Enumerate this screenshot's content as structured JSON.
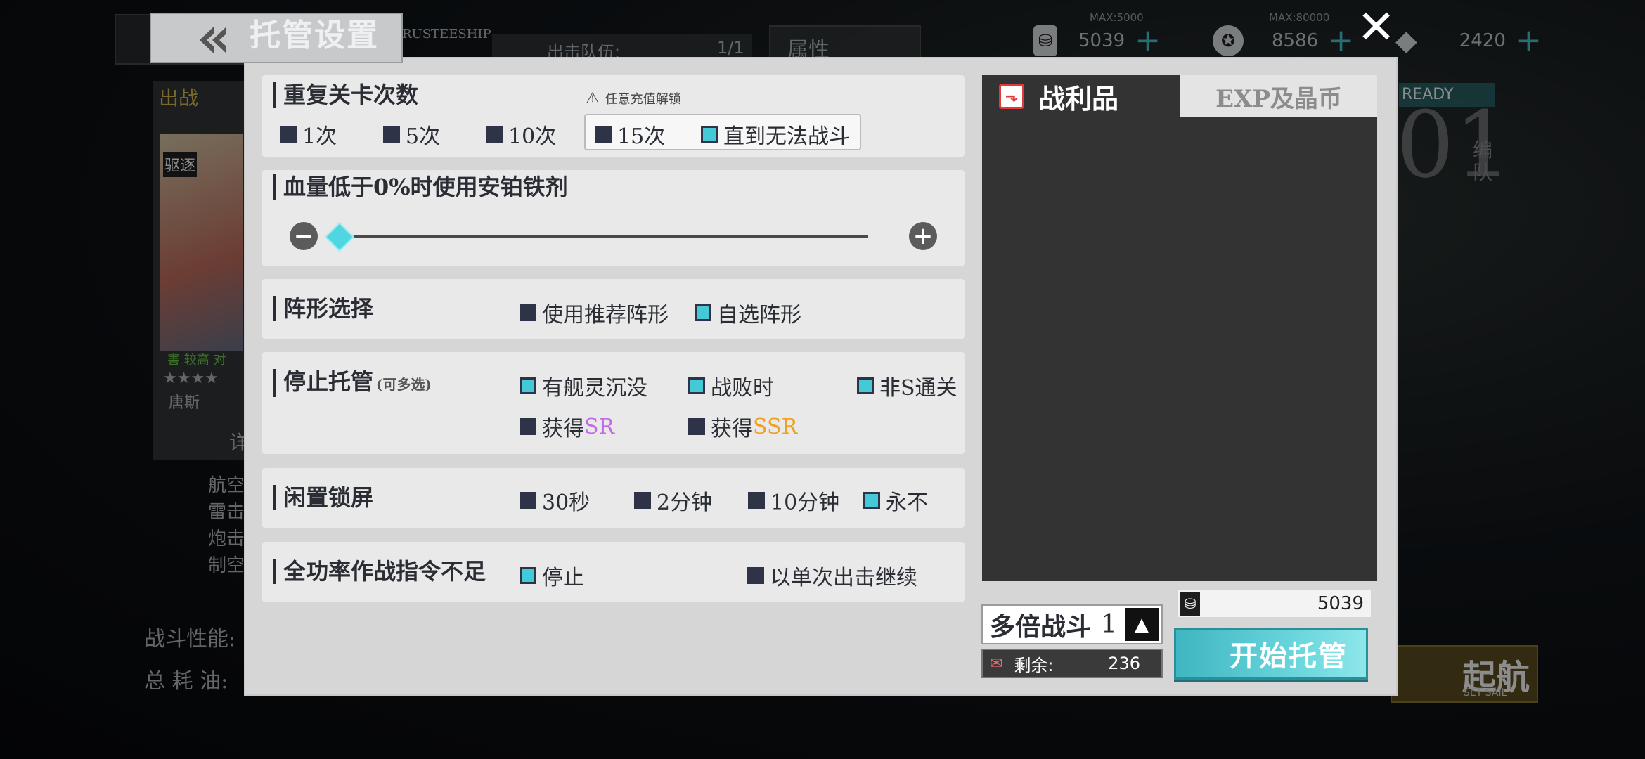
{
  "background": {
    "resources": [
      {
        "name": "oil",
        "max": "MAX:5000",
        "value": "5039"
      },
      {
        "name": "coin",
        "max": "MAX:80000",
        "value": "8586"
      },
      {
        "name": "gem",
        "value": "2420"
      }
    ],
    "fleet_label": "出击队伍:",
    "fleet_count": "1/1",
    "attribute_label": "属性",
    "trusteeship_en": "TRUSTEESHIP",
    "sortie_label": "出战",
    "ready_label": "READY",
    "fleet_number": "01",
    "fleet_word": "编队",
    "ship_name": "唐斯",
    "ship_type": "驱逐",
    "ship_tags": "害 较高  对",
    "ship_stars": "★★★★",
    "detail_label": "详",
    "stat_rows": [
      "航空",
      "雷击",
      "炮击",
      "制空"
    ],
    "perf_label": "战斗性能:",
    "total_oil_label": "总 耗 油:",
    "sail_label": "起航",
    "sail_en": "SET SAIL"
  },
  "dialog": {
    "title": "托管设置",
    "sections": {
      "repeat": {
        "title": "重复关卡次数",
        "unlock_note": "任意充值解锁",
        "options": [
          {
            "label": "1次",
            "checked": false
          },
          {
            "label": "5次",
            "checked": false
          },
          {
            "label": "10次",
            "checked": false
          },
          {
            "label": "15次",
            "checked": false
          },
          {
            "label": "直到无法战斗",
            "checked": true
          }
        ]
      },
      "hp": {
        "title": "血量低于0%时使用安铂铁剂",
        "slider_value_percent": 0
      },
      "formation": {
        "title": "阵形选择",
        "options": [
          {
            "label": "使用推荐阵形",
            "checked": false
          },
          {
            "label": "自选阵形",
            "checked": true
          }
        ]
      },
      "stop": {
        "title": "停止托管",
        "title_note": "(可多选)",
        "options": [
          {
            "label": "有舰灵沉没",
            "checked": true
          },
          {
            "label": "战败时",
            "checked": true
          },
          {
            "label": "非S通关",
            "checked": true
          }
        ],
        "get_label": "获得",
        "sr": "SR",
        "ssr": "SSR",
        "sr_checked": false,
        "ssr_checked": false
      },
      "idle": {
        "title": "闲置锁屏",
        "options": [
          {
            "label": "30秒",
            "checked": false
          },
          {
            "label": "2分钟",
            "checked": false
          },
          {
            "label": "10分钟",
            "checked": false
          },
          {
            "label": "永不",
            "checked": true
          }
        ]
      },
      "power": {
        "title": "全功率作战指令不足",
        "options": [
          {
            "label": "停止",
            "checked": true
          },
          {
            "label": "以单次出击继续",
            "checked": false
          }
        ]
      }
    },
    "tabs": {
      "loot": "战利品",
      "exp": "EXP及晶币"
    },
    "multi_battle_label": "多倍战斗",
    "multi_battle_value": "1",
    "remaining_label": "剩余:",
    "remaining_value": "236",
    "oil_value": "5039",
    "start_button": "开始托管"
  },
  "colors": {
    "accent": "#45c9d6",
    "sr": "#c46ae8",
    "ssr": "#f0a020"
  }
}
